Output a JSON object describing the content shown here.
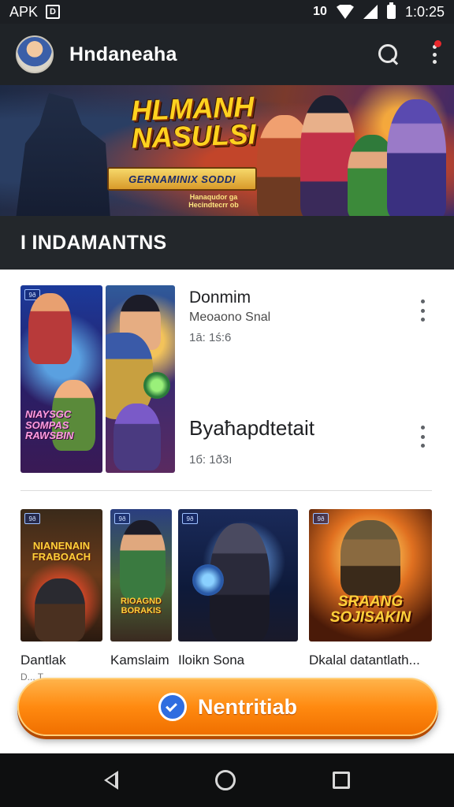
{
  "status_bar": {
    "left_text": "APK",
    "app_badge": "D",
    "time": "1:0:25",
    "vibrate_label": "10"
  },
  "app_bar": {
    "title": "Hndaneaha"
  },
  "banner": {
    "title": "HLMANH NASULSI",
    "ribbon": "GERNAMINIX SODDI",
    "sub": "Hanaqudor ga Hecindtecrr ob"
  },
  "section": {
    "title": "I INDAMANTNS"
  },
  "featured": {
    "cover_badge_a": "9ð",
    "cover_title_a": "NIAYSGC SOMPAS RAWSBIN",
    "items": [
      {
        "title": "Donmim",
        "subtitle": "Meoaono Snal",
        "meta": "1ā: 1ś:6"
      },
      {
        "title": "Byaħapdtetait",
        "subtitle": "",
        "meta": "1б: 1ð3ı"
      }
    ]
  },
  "grid": {
    "tiles": [
      {
        "label": "Dantlak",
        "badge": "9ð",
        "art_text": "NIANENAIN FRABOACH"
      },
      {
        "label": "Kamslaim",
        "badge": "9ð",
        "art_text": "RIOAGND BORAKIS"
      },
      {
        "label": "Iloikn Sona",
        "badge": "9ð",
        "art_text": ""
      },
      {
        "label": "Dkalal datantlath...",
        "badge": "9ð",
        "art_text": "SRAANG SOJISAKIN"
      }
    ],
    "sublabel": "D... T..."
  },
  "cta": {
    "label": "Nentritiab"
  },
  "colors": {
    "status_bg": "#1c1f23",
    "app_bar_bg": "#1f2327",
    "section_bg": "#23272b",
    "cta_orange": "#ff8a10",
    "cta_icon_blue": "#2f6de0",
    "notification_red": "#e8282c"
  },
  "icons": {
    "search": "search-icon",
    "more": "more-vertical-icon",
    "back": "back-triangle-icon",
    "home": "home-circle-icon",
    "recents": "recents-square-icon"
  }
}
